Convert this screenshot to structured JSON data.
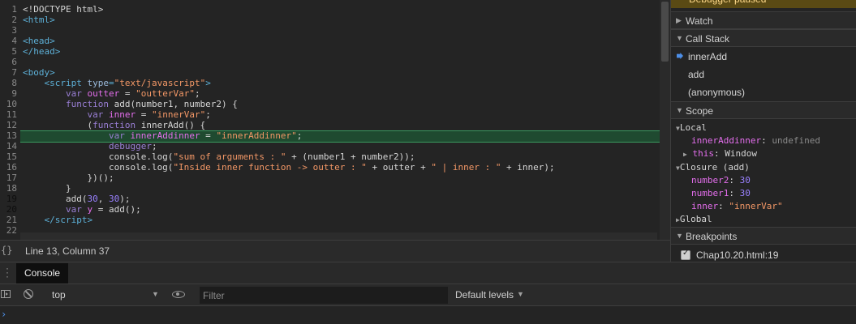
{
  "editor": {
    "lines": [
      {
        "num": "1",
        "html": "&lt;!DOCTYPE html&gt;"
      },
      {
        "num": "2",
        "html": "<span class=\"tag\">&lt;html&gt;</span>"
      },
      {
        "num": "3",
        "html": ""
      },
      {
        "num": "4",
        "html": "<span class=\"tag\">&lt;head&gt;</span>"
      },
      {
        "num": "5",
        "html": "<span class=\"tag\">&lt;/head&gt;</span>"
      },
      {
        "num": "6",
        "html": ""
      },
      {
        "num": "7",
        "html": "<span class=\"tag\">&lt;body&gt;</span>"
      },
      {
        "num": "8",
        "html": "    <span class=\"tag\">&lt;script </span><span class=\"attr\">type</span><span class=\"tag\">=</span><span class=\"str\">\"text/javascript\"</span><span class=\"tag\">&gt;</span>"
      },
      {
        "num": "9",
        "html": "        <span class=\"kw\">var</span> <span class=\"var\">outter</span> = <span class=\"str\">\"outterVar\"</span>;"
      },
      {
        "num": "10",
        "html": "        <span class=\"kw\">function</span> add(number1, number2) {"
      },
      {
        "num": "11",
        "html": "            <span class=\"kw\">var</span> <span class=\"var\">inner</span> = <span class=\"str\">\"innerVar\"</span>;"
      },
      {
        "num": "12",
        "html": "            (<span class=\"kw\">function</span> innerAdd() {"
      },
      {
        "num": "13",
        "html": "                <span class=\"kw\">var</span> <span class=\"var\">innerAddinner</span> = <span class=\"str\">\"innerAddinner\"</span>;"
      },
      {
        "num": "14",
        "html": "                <span class=\"kw\">debugger</span>;"
      },
      {
        "num": "15",
        "html": "                console.log(<span class=\"str\">\"sum of arguments : \"</span> + (number1 + number2));"
      },
      {
        "num": "16",
        "html": "                console.log(<span class=\"str\">\"Inside inner function -&gt; outter : \"</span> + outter + <span class=\"str\">\" | inner : \"</span> + inner);"
      },
      {
        "num": "17",
        "html": "            })();"
      },
      {
        "num": "18",
        "html": "        }"
      },
      {
        "num": "19",
        "html": "        add(<span class=\"num\">30</span>, <span class=\"num\">30</span>);",
        "bp": true
      },
      {
        "num": "20",
        "html": "        <span class=\"kw\">var</span> <span class=\"var\">y</span> = add();",
        "bp": true
      },
      {
        "num": "21",
        "html": "    <span class=\"tag\">&lt;/script&gt;</span>"
      },
      {
        "num": "22",
        "html": ""
      }
    ]
  },
  "status": {
    "braces": "{}",
    "cursor": "Line 13, Column 37"
  },
  "sidebar": {
    "paused": "Debugger paused",
    "watch": "Watch",
    "call_stack": "Call Stack",
    "frames": [
      "innerAdd",
      "add",
      "(anonymous)"
    ],
    "scope": "Scope",
    "local": "Local",
    "local_var_name": "innerAddinner",
    "local_var_value": "undefined",
    "this_name": "this",
    "this_value": "Window",
    "closure": "Closure (add)",
    "closure_vars": [
      {
        "name": "number2",
        "value": "30"
      },
      {
        "name": "number1",
        "value": "30"
      }
    ],
    "inner_name": "inner",
    "inner_value": "\"innerVar\"",
    "global": "Global",
    "breakpoints": "Breakpoints",
    "breakpoint_item": "Chap10.20.html:19"
  },
  "drawer": {
    "tab": "Console",
    "context": "top",
    "filter_placeholder": "Filter",
    "levels": "Default levels",
    "prompt": "›"
  },
  "colors": {
    "accent_blue": "#4d8fe8",
    "breakpoint_green": "#6a9a23",
    "highlight_line": "#1f4a30",
    "string": "#f29766",
    "keyword": "#9a7fd5",
    "variable": "#e36eec"
  }
}
